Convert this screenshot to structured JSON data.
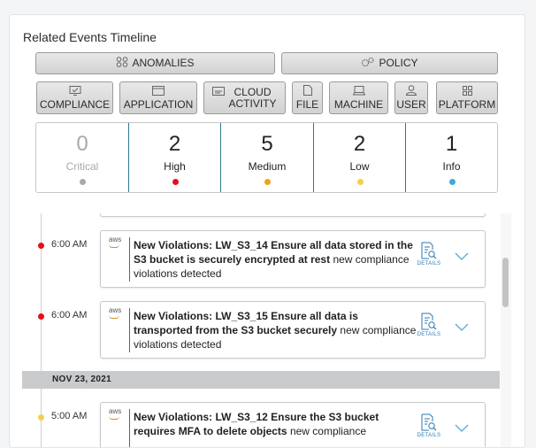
{
  "panel": {
    "title": "Related Events Timeline"
  },
  "filters_row1": [
    {
      "label": "ANOMALIES",
      "icon": "anomalies-icon"
    },
    {
      "label": "POLICY",
      "icon": "policy-icon"
    }
  ],
  "filters_row2": [
    {
      "label": "COMPLIANCE",
      "icon": "compliance-icon"
    },
    {
      "label": "APPLICATION",
      "icon": "application-icon"
    },
    {
      "label_line1": "CLOUD",
      "label_line2": "ACTIVITY",
      "icon": "cloud-activity-icon"
    },
    {
      "label": "FILE",
      "icon": "file-icon"
    },
    {
      "label": "MACHINE",
      "icon": "machine-icon"
    },
    {
      "label": "USER",
      "icon": "user-icon"
    },
    {
      "label": "PLATFORM",
      "icon": "platform-icon"
    }
  ],
  "severity": [
    {
      "count": "0",
      "label": "Critical",
      "color": "#a9a9a9"
    },
    {
      "count": "2",
      "label": "High",
      "color": "#e3101b"
    },
    {
      "count": "5",
      "label": "Medium",
      "color": "#f0a21b"
    },
    {
      "count": "2",
      "label": "Low",
      "color": "#f5cf4a"
    },
    {
      "count": "1",
      "label": "Info",
      "color": "#41a8e0"
    }
  ],
  "timeline": {
    "events": [
      {
        "time": "6:00 AM",
        "severity_color": "#e3101b",
        "provider": "aws",
        "title_bold": "New Violations: LW_S3_14 Ensure all data stored in the S3 bucket is securely encrypted at rest",
        "title_rest": " new compliance violations detected",
        "details_label": "DETAILS"
      },
      {
        "time": "6:00 AM",
        "severity_color": "#e3101b",
        "provider": "aws",
        "title_bold": "New Violations: LW_S3_15 Ensure all data is transported from the S3 bucket securely",
        "title_rest": " new compliance violations detected",
        "details_label": "DETAILS"
      },
      {
        "time": "5:00 AM",
        "severity_color": "#f5cf4a",
        "provider": "aws",
        "title_bold": "New Violations: LW_S3_12 Ensure the S3 bucket requires MFA to delete objects",
        "title_rest": " new compliance",
        "details_label": "DETAILS"
      }
    ],
    "date_band": "NOV 23, 2021"
  }
}
